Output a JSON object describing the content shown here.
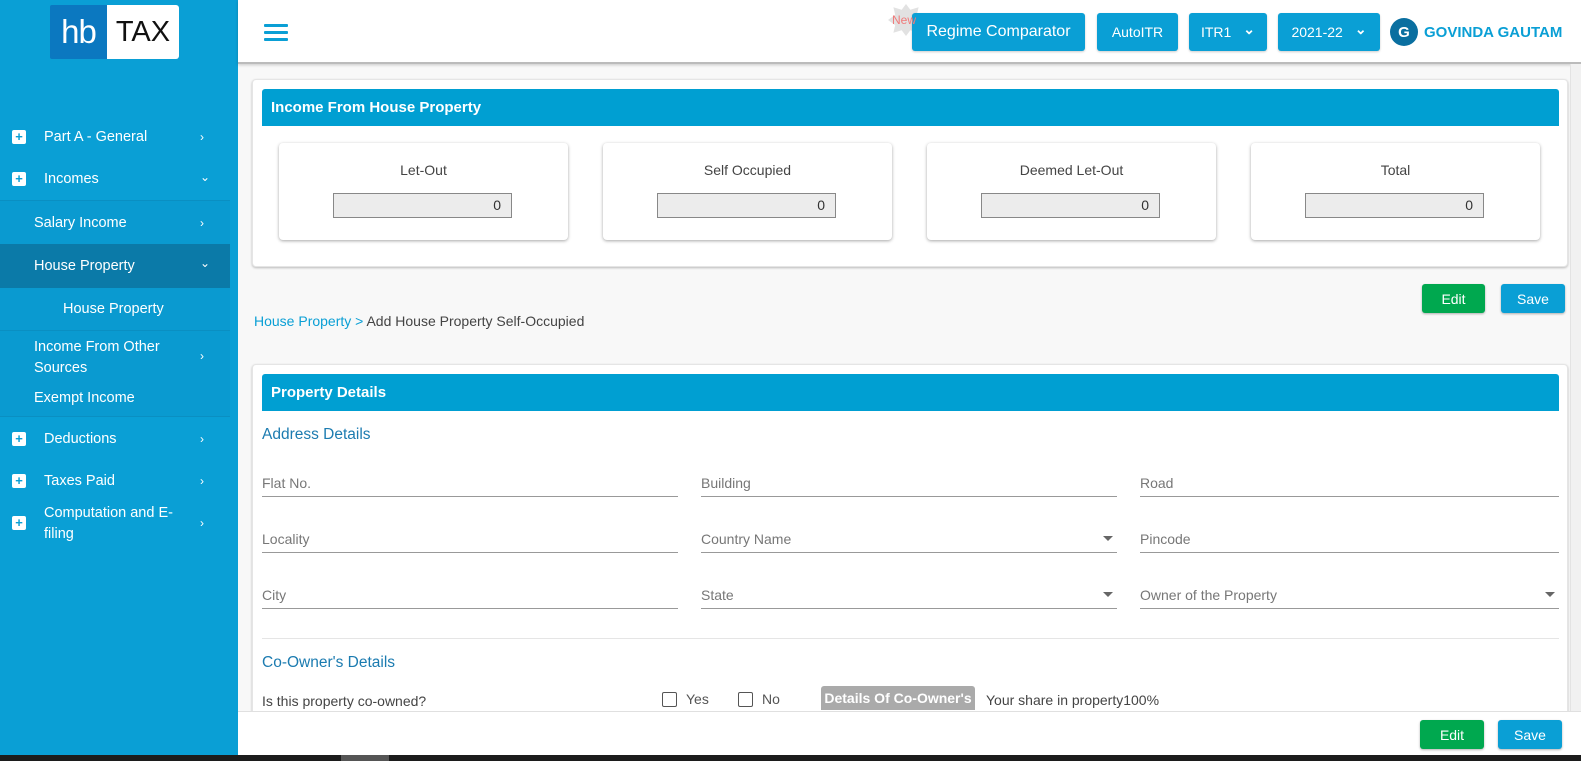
{
  "brand": {
    "logo_left": "hb",
    "logo_right": "TAX"
  },
  "sidebar": {
    "items": [
      {
        "label": "Part A - General",
        "icon": "plus-square-icon",
        "chevron": "›"
      },
      {
        "label": "Incomes",
        "icon": "plus-square-icon",
        "chevron": "⌄"
      },
      {
        "label": "Salary Income",
        "chevron": "›"
      },
      {
        "label": "House Property",
        "chevron": "⌄",
        "active": true
      },
      {
        "label": "House Property"
      },
      {
        "label": "Income From Other",
        "label2": "Sources",
        "chevron": "›"
      },
      {
        "label": "Exempt Income"
      },
      {
        "label": "Deductions",
        "icon": "plus-square-icon",
        "chevron": "›"
      },
      {
        "label": "Taxes Paid",
        "icon": "plus-square-icon",
        "chevron": "›"
      },
      {
        "label": "Computation and E-",
        "label2": "filing",
        "icon": "plus-square-icon",
        "chevron": "›"
      }
    ]
  },
  "header": {
    "new_badge": "New",
    "regime_comparator": "Regime Comparator",
    "autoitr": "AutoITR",
    "itr_select": "ITR1",
    "year_select": "2021-22",
    "chevron": "⌄",
    "user_initial": "G",
    "user_name": "GOVINDA GAUTAM"
  },
  "income_panel": {
    "title": "Income From House Property",
    "cards": [
      {
        "label": "Let-Out",
        "value": "0"
      },
      {
        "label": "Self Occupied",
        "value": "0"
      },
      {
        "label": "Deemed Let-Out",
        "value": "0"
      },
      {
        "label": "Total",
        "value": "0"
      }
    ],
    "edit_label": "Edit",
    "save_label": "Save"
  },
  "breadcrumb": {
    "link": "House Property",
    "separator": " > ",
    "current": "Add House Property Self-Occupied"
  },
  "property_panel": {
    "title": "Property Details",
    "address_title": "Address Details",
    "fields": [
      {
        "placeholder": "Flat No.",
        "type": "text"
      },
      {
        "placeholder": "Building",
        "type": "text"
      },
      {
        "placeholder": "Road",
        "type": "text"
      },
      {
        "placeholder": "Locality",
        "type": "text"
      },
      {
        "placeholder": "Country Name",
        "type": "select"
      },
      {
        "placeholder": "Pincode",
        "type": "text"
      },
      {
        "placeholder": "City",
        "type": "text"
      },
      {
        "placeholder": "State",
        "type": "select"
      },
      {
        "placeholder": "Owner of the Property",
        "type": "select"
      }
    ],
    "coowner_title": "Co-Owner's Details",
    "coowned_question": "Is this property co-owned?",
    "yes_label": "Yes",
    "no_label": "No",
    "yes_checked": false,
    "no_checked": false,
    "coowner_button": "Details Of Co-Owner's",
    "share_text": "Your share in property100%"
  },
  "footer": {
    "edit_label": "Edit",
    "save_label": "Save"
  },
  "colors": {
    "primary": "#0a9fd5",
    "edit_green": "#00a84f",
    "sidebar_active": "#0b7aa8"
  }
}
